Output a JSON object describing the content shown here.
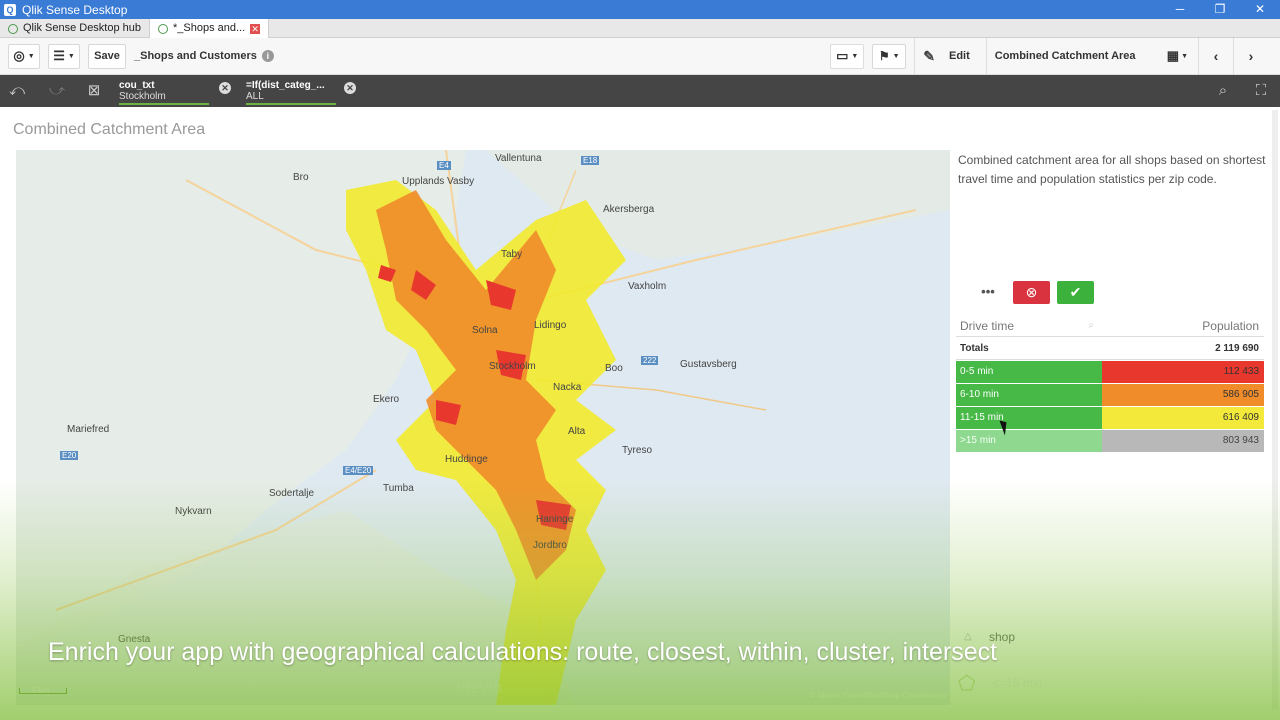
{
  "window": {
    "title": "Qlik Sense Desktop",
    "minimize": "─",
    "maximize": "❐",
    "close": "✕"
  },
  "tabs": [
    {
      "label": "Qlik Sense Desktop hub"
    },
    {
      "label": "*_Shops and..."
    }
  ],
  "toolbar": {
    "save_label": "Save",
    "app_name": "_Shops and Customers",
    "edit_label": "Edit",
    "sheet_name": "Combined Catchment Area"
  },
  "selections": [
    {
      "field": "cou_txt",
      "value": "Stockholm"
    },
    {
      "field": "=If(dist_categ_...",
      "value": "ALL"
    }
  ],
  "sheet": {
    "title": "Combined Catchment Area",
    "description": "Combined catchment area for all shops based on shortest travel time and population statistics per zip code."
  },
  "map": {
    "places": [
      {
        "name": "Vallentuna"
      },
      {
        "name": "Bro"
      },
      {
        "name": "Upplands Vasby"
      },
      {
        "name": "Akersberga"
      },
      {
        "name": "Taby"
      },
      {
        "name": "Vaxholm"
      },
      {
        "name": "Lidingo"
      },
      {
        "name": "Solna"
      },
      {
        "name": "Stockholm"
      },
      {
        "name": "Boo"
      },
      {
        "name": "Gustavsberg"
      },
      {
        "name": "Nacka"
      },
      {
        "name": "Ekero"
      },
      {
        "name": "Mariefred"
      },
      {
        "name": "Huddinge"
      },
      {
        "name": "Alta"
      },
      {
        "name": "Tyreso"
      },
      {
        "name": "Sodertalje"
      },
      {
        "name": "Tumba"
      },
      {
        "name": "Nykvarn"
      },
      {
        "name": "Haninge"
      },
      {
        "name": "Jordbro"
      },
      {
        "name": "Gnesta"
      }
    ],
    "road_labels": [
      "E4",
      "E18",
      "E20",
      "222",
      "E4/E20",
      "E20"
    ],
    "scale": "5 km",
    "attribution": "© Idevio, OpenStreetMap Contributors",
    "watermark": "idevio"
  },
  "table": {
    "more_icon": "more-icon",
    "headers": {
      "dim": "Drive time",
      "measure": "Population"
    },
    "totals": {
      "label": "Totals",
      "value": "2 119 690"
    },
    "rows": [
      {
        "label": "0-5 min",
        "value": "112 433",
        "color": "#e8382e",
        "state": "selected"
      },
      {
        "label": "6-10 min",
        "value": "586 905",
        "color": "#f08c2a",
        "state": "selected"
      },
      {
        "label": "11-15 min",
        "value": "616 409",
        "color": "#f2e93a",
        "state": "selected"
      },
      {
        "label": ">15 min",
        "value": "803 943",
        "color": "#b8b8b8",
        "state": "possible"
      }
    ],
    "selected_color": "#46b946",
    "possible_color": "#8fd88f"
  },
  "legend": [
    {
      "icon": "triangle-icon",
      "label": "shop"
    },
    {
      "icon": "pentagon-icon",
      "label": "<=15 min"
    }
  ],
  "caption": "Enrich your app with geographical calculations: route, closest, within, cluster, intersect"
}
